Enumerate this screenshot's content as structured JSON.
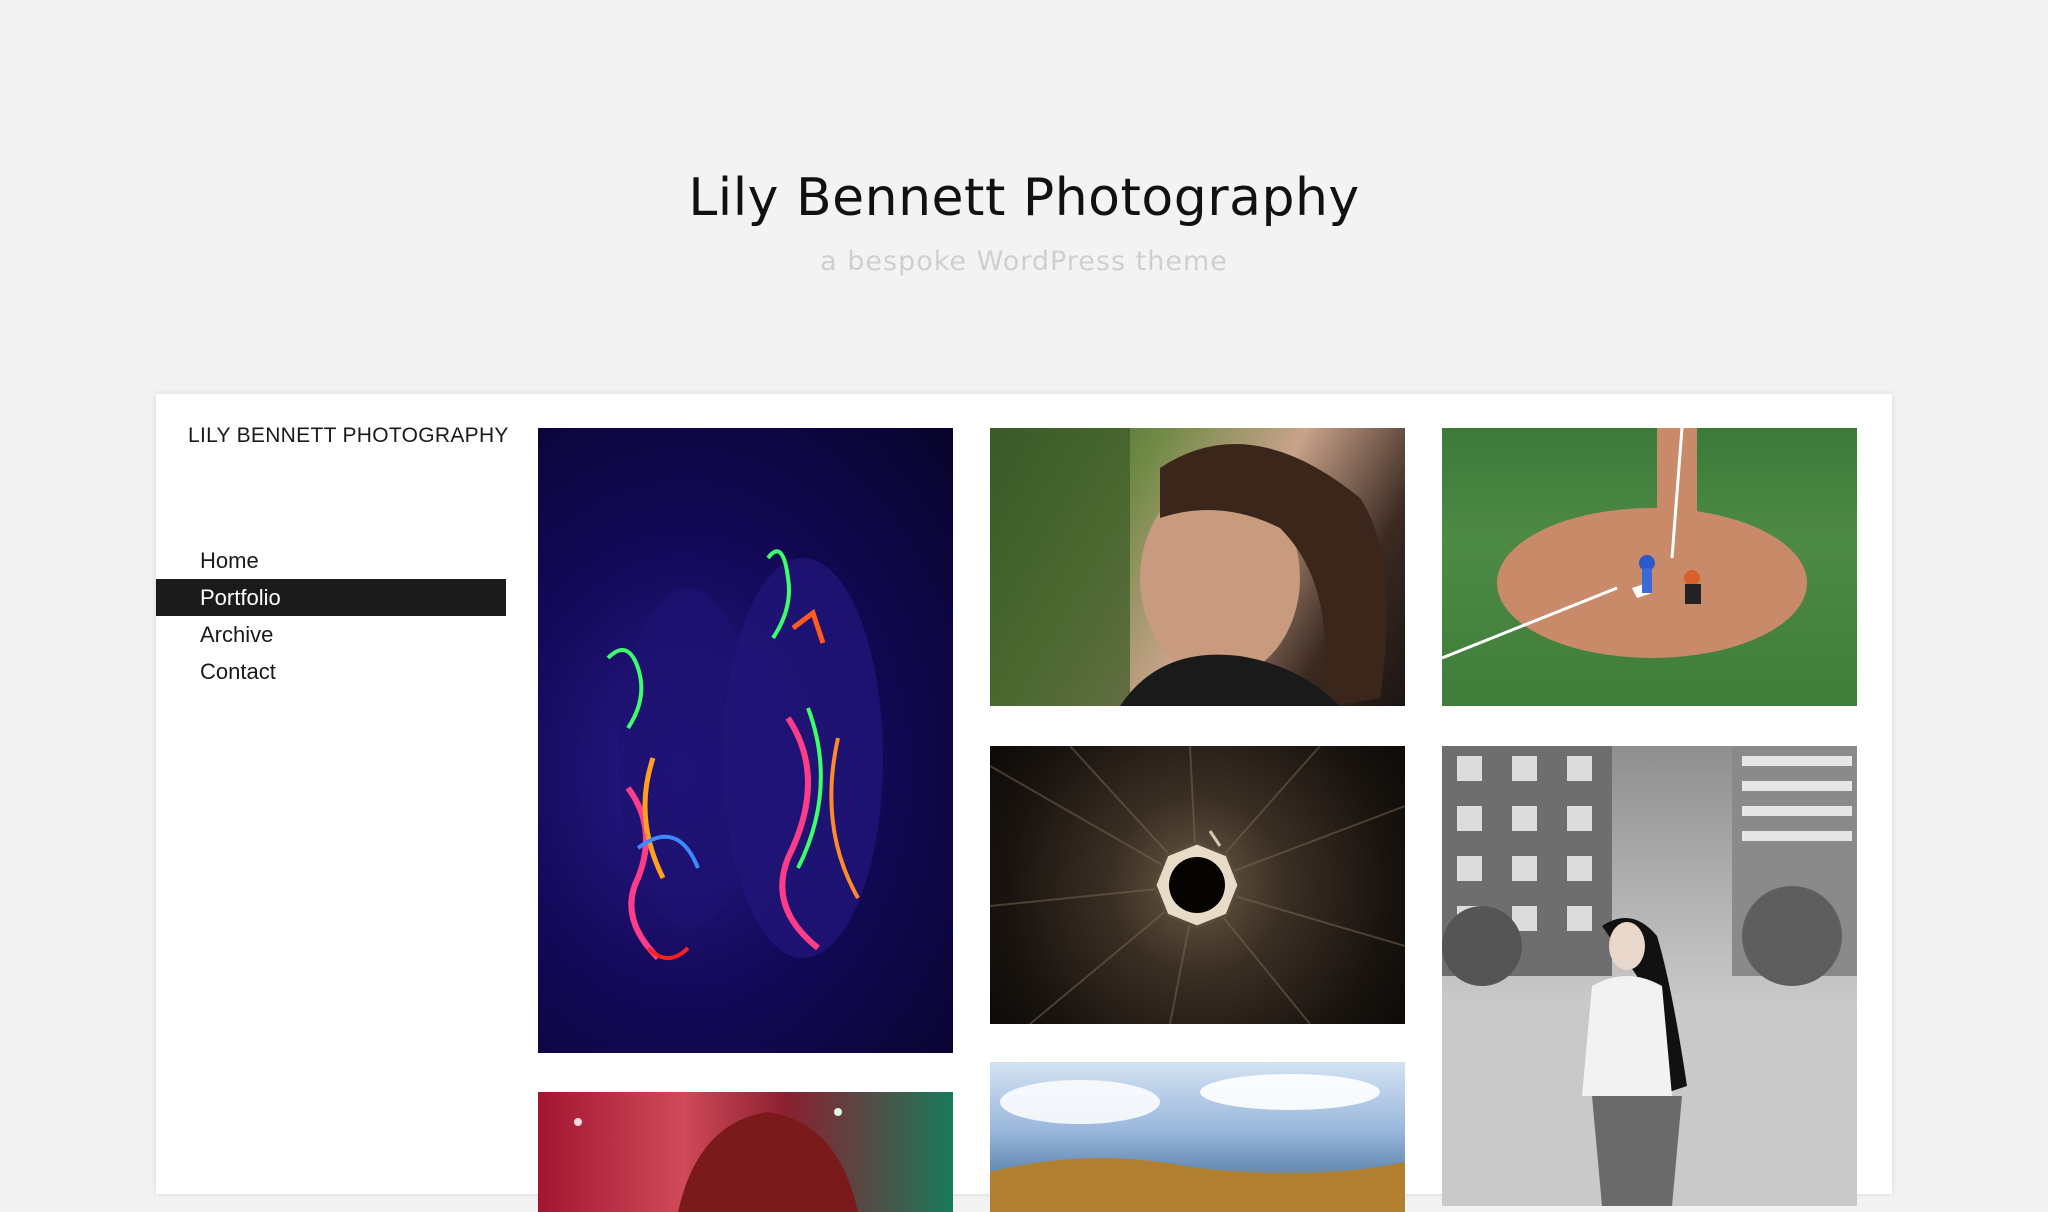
{
  "hero": {
    "title": "Lily Bennett Photography",
    "subtitle": "a bespoke WordPress theme"
  },
  "site": {
    "name": "LILY BENNETT PHOTOGRAPHY"
  },
  "nav": {
    "items": [
      {
        "label": "Home",
        "active": false
      },
      {
        "label": "Portfolio",
        "active": true
      },
      {
        "label": "Archive",
        "active": false
      },
      {
        "label": "Contact",
        "active": false
      }
    ]
  },
  "colors": {
    "page_background": "#f3f3f3",
    "nav_active_background": "#1b1b1b",
    "nav_active_text": "#ffffff",
    "subtitle": "#cfcfcf"
  },
  "gallery": {
    "photos": [
      {
        "subject": "neon body paint portrait"
      },
      {
        "subject": "woman portrait outdoors"
      },
      {
        "subject": "baseball home plate aerial"
      },
      {
        "subject": "abstract lamp from below"
      },
      {
        "subject": "black and white street portrait"
      },
      {
        "subject": "red hair portrait"
      },
      {
        "subject": "sky and autumn landscape"
      }
    ]
  }
}
